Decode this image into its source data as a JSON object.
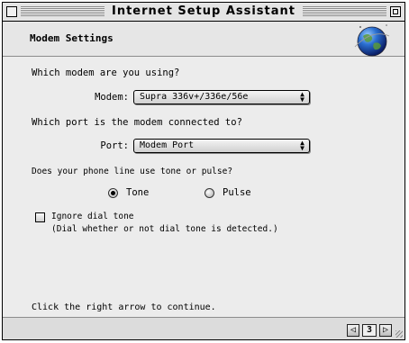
{
  "window": {
    "title": "Internet Setup Assistant"
  },
  "header": {
    "title": "Modem Settings"
  },
  "modem": {
    "question": "Which modem are you using?",
    "label": "Modem:",
    "selected": "Supra 336v+/336e/56e"
  },
  "port": {
    "question": "Which port is the modem connected to?",
    "label": "Port:",
    "selected": "Modem Port"
  },
  "dial": {
    "question": "Does your phone line use tone or pulse?",
    "tone_label": "Tone",
    "pulse_label": "Pulse",
    "selected": "Tone"
  },
  "ignore": {
    "label": "Ignore dial tone",
    "hint": "(Dial whether or not dial tone is detected.)",
    "checked": false
  },
  "footer": {
    "instruction": "Click the right arrow to continue.",
    "page_number": "3"
  }
}
